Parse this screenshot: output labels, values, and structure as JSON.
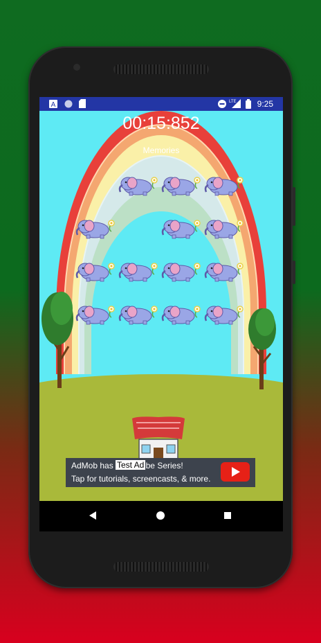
{
  "statusbar": {
    "notif_a": "A",
    "lte": "LTE",
    "time": "9:25"
  },
  "game": {
    "timer": "00:15:852",
    "title": "Memories",
    "cards": [
      {
        "row": 0,
        "col": 1,
        "face": "elephant"
      },
      {
        "row": 0,
        "col": 2,
        "face": "elephant"
      },
      {
        "row": 0,
        "col": 3,
        "face": "elephant"
      },
      {
        "row": 1,
        "col": 0,
        "face": "elephant"
      },
      {
        "row": 1,
        "col": 2,
        "face": "elephant"
      },
      {
        "row": 1,
        "col": 3,
        "face": "elephant"
      },
      {
        "row": 2,
        "col": 0,
        "face": "elephant"
      },
      {
        "row": 2,
        "col": 1,
        "face": "elephant"
      },
      {
        "row": 2,
        "col": 2,
        "face": "elephant"
      },
      {
        "row": 2,
        "col": 3,
        "face": "elephant"
      },
      {
        "row": 3,
        "col": 0,
        "face": "elephant"
      },
      {
        "row": 3,
        "col": 1,
        "face": "elephant"
      },
      {
        "row": 3,
        "col": 2,
        "face": "elephant"
      },
      {
        "row": 3,
        "col": 3,
        "face": "elephant"
      }
    ],
    "home_icon": "house-icon"
  },
  "ad": {
    "line1": "AdMob has a YouTube Series!",
    "line2": "Tap for tutorials, screencasts, & more.",
    "test_label": "Test Ad",
    "icon": "youtube-play-icon"
  },
  "navbar": {
    "back": "back-icon",
    "home": "home-icon",
    "recents": "recents-icon"
  },
  "colors": {
    "status_bar": "#2336a5",
    "sky": "#5eeaf4",
    "grass": "#a9b93a",
    "ad_bg": "#3d434d",
    "youtube_red": "#e62117"
  }
}
